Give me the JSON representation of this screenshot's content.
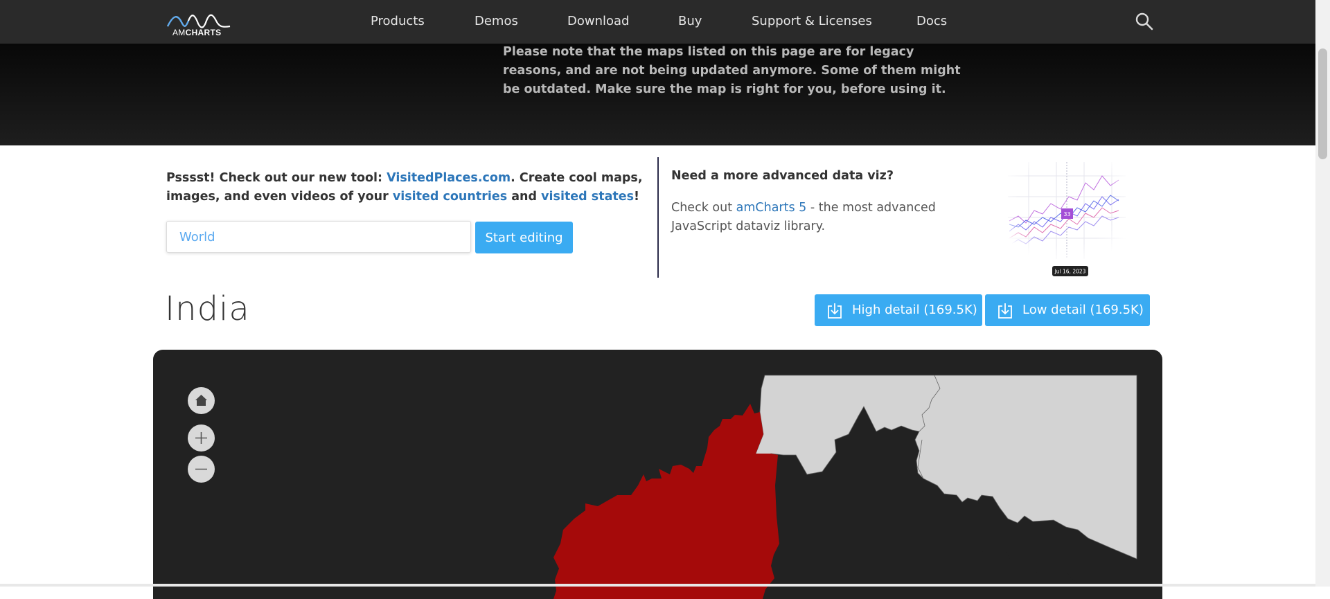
{
  "nav": {
    "logo": {
      "prefix": "AM",
      "suffix": "CHARTS"
    },
    "items": [
      "Products",
      "Demos",
      "Download",
      "Buy",
      "Support & Licenses",
      "Docs"
    ],
    "search_icon": "search-icon"
  },
  "notice": {
    "text": "Please note that the maps listed on this page are for legacy reasons, and are not being updated anymore. Some of them might be outdated. Make sure the map is right for you, before using it."
  },
  "promo": {
    "left_intro": "Psssst! Check out our new tool: ",
    "link_site": "VisitedPlaces.com",
    "left_middle": ". Create cool maps, images, and even videos of your ",
    "link_countries": "visited countries",
    "left_and": " and ",
    "link_states": "visited states",
    "left_end": "!",
    "select_value": "World",
    "start_button": "Start editing",
    "right_title": "Need a more advanced data viz?",
    "right_prefix": "Check out ",
    "right_link": "amCharts 5",
    "right_suffix": " - the most advanced JavaScript dataviz library.",
    "chart_badge": "33",
    "chart_date": "Jul 16, 2023"
  },
  "country": {
    "title": "India",
    "high_detail": "High detail (169.5K)",
    "low_detail": "Low detail (169.5K)"
  },
  "map": {
    "highlight_color": "#a50a0a",
    "neighbor_color": "#d3d3d3",
    "background_color": "#222222",
    "controls": [
      "home-icon",
      "zoom-in-icon",
      "zoom-out-icon"
    ]
  },
  "colors": {
    "accent": "#3aabf2",
    "link": "#2c76b9",
    "nav_bg": "#2a2a2a"
  }
}
